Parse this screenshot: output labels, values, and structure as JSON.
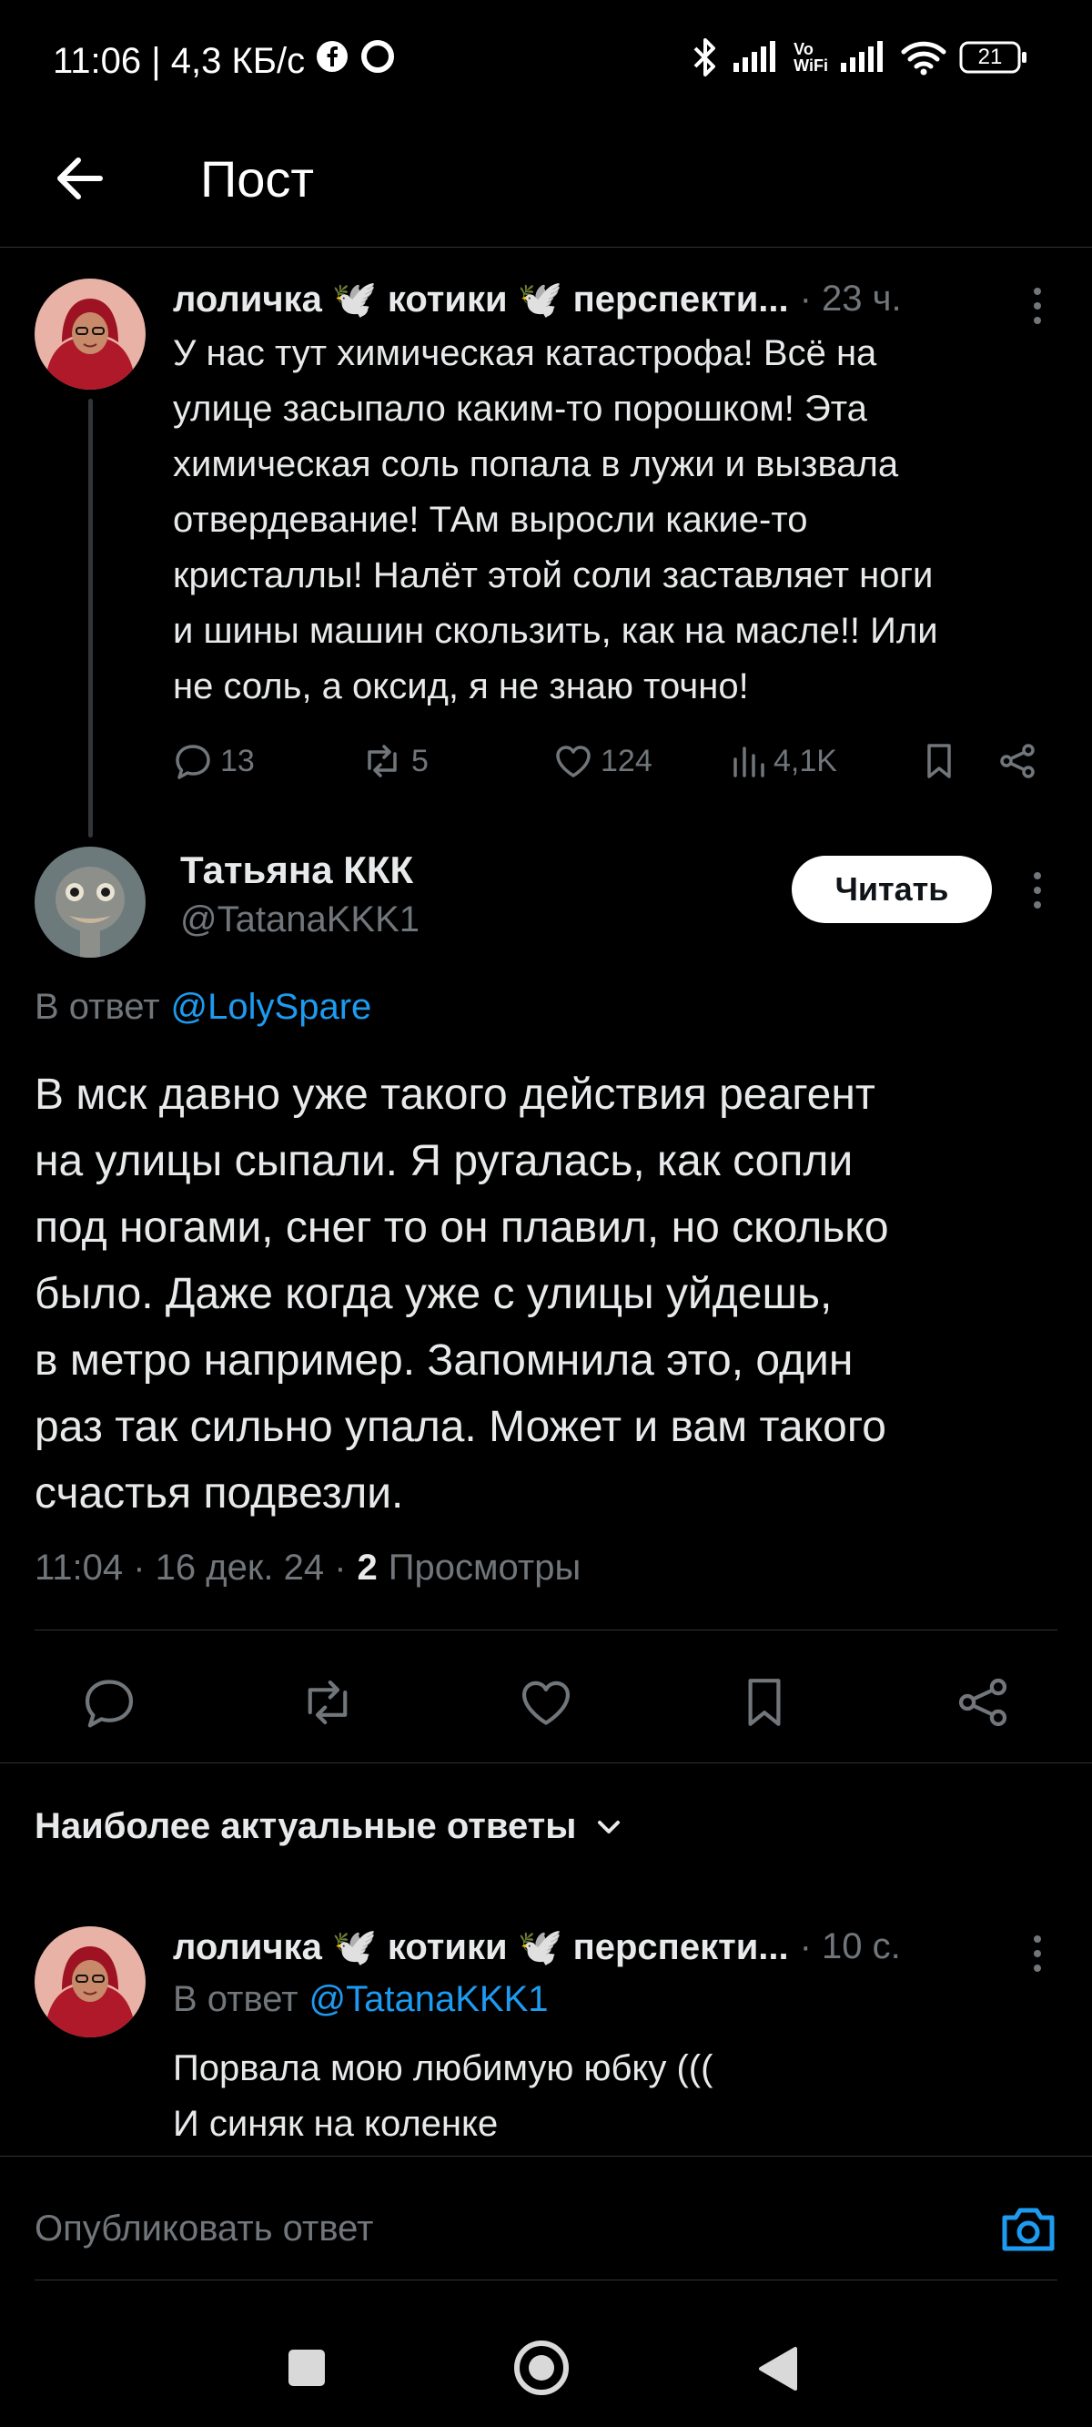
{
  "status_bar": {
    "time": "11:06 | 4,3 КБ/с",
    "battery": "21",
    "vowifi": "Vo\nWiFi"
  },
  "header": {
    "title": "Пост"
  },
  "post1": {
    "author": "лоличка 🕊️ котики 🕊️ перспекти...",
    "time": "· 23 ч.",
    "text_lines": [
      "У нас тут химическая катастрофа! Всё на",
      "улице засыпало каким-то порошком! Эта",
      "химическая соль попала в лужи и вызвала",
      "отвердевание! ТАм выросли какие-то",
      "кристаллы! Налёт этой соли заставляет ноги",
      "и шины машин скользить, как на масле!! Или",
      "не соль, а оксид, я не знаю точно!"
    ],
    "replies": "13",
    "reposts": "5",
    "likes": "124",
    "views": "4,1K"
  },
  "main_post": {
    "author": "Татьяна ККК",
    "handle": "@TatanaKKK1",
    "follow_label": "Читать",
    "reply_prefix": "В ответ",
    "reply_handle": "@LolySpare",
    "text_lines": [
      "В мск давно уже такого действия реагент",
      "на улицы сыпали. Я ругалась, как сопли",
      "под ногами, снег то он плавил, но сколько",
      "было. Даже когда уже с улицы уйдешь,",
      "в метро например. Запомнила это, один",
      "раз так сильно упала. Может и вам такого",
      "счастья подвезли."
    ],
    "meta_time": "11:04 · 16 дек. 24 ·",
    "views_count": "2",
    "views_label": "Просмотры"
  },
  "sort": {
    "label": "Наиболее актуальные ответы"
  },
  "reply1": {
    "author": "лоличка 🕊️ котики 🕊️ перспекти...",
    "time": "· 10 с.",
    "reply_prefix": "В ответ",
    "reply_handle": "@TatanaKKK1",
    "text_lines": [
      "Порвала мою любимую юбку (((",
      "И синяк на коленке"
    ]
  },
  "composer": {
    "placeholder": "Опубликовать ответ"
  },
  "colors": {
    "accent": "#1d9bf0",
    "muted": "#71767b",
    "background": "#000000"
  }
}
